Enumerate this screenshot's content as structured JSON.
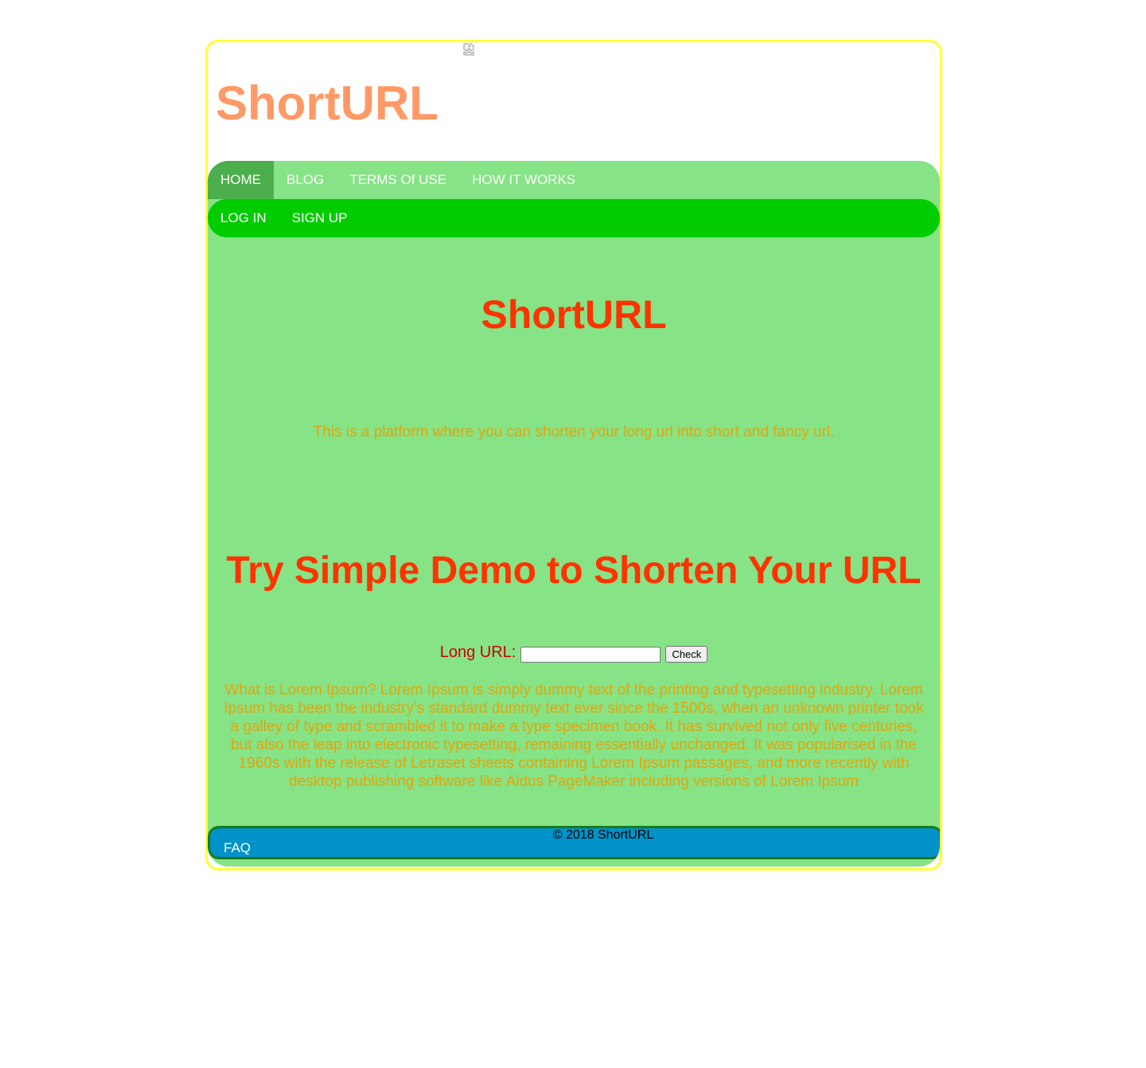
{
  "header": {
    "site_title": "ShortURL"
  },
  "nav": {
    "primary": [
      {
        "label": "HOME",
        "active": true
      },
      {
        "label": "BLOG",
        "active": false
      },
      {
        "label": "TERMS Of USE",
        "active": false
      },
      {
        "label": "HOW IT WORKS",
        "active": false
      }
    ],
    "secondary": [
      {
        "label": "LOG IN"
      },
      {
        "label": "SIGN UP"
      }
    ]
  },
  "main": {
    "hero_title": "ShortURL",
    "tagline": "This is a platform where you can shorten your long url into short and fancy url.",
    "demo_title": "Try Simple Demo to Shorten Your URL",
    "form": {
      "label": "Long URL:",
      "input_value": "",
      "button_label": "Check"
    },
    "lorem": "What is Lorem Ipsum? Lorem Ipsum is simply dummy text of the printing and typesetting industry. Lorem Ipsum has been the industry's standard dummy text ever since the 1500s, when an unknown printer took a galley of type and scrambled it to make a type specimen book. It has survived not only five centuries, but also the leap into electronic typesetting, remaining essentially unchanged. It was popularised in the 1960s with the release of Letraset sheets containing Lorem Ipsum passages, and more recently with desktop publishing software like Aldus PageMaker including versions of Lorem Ipsum"
  },
  "footer": {
    "faq_label": "FAQ",
    "copyright": "© 2018 ShortURL"
  },
  "colors": {
    "frame_border": "#ffff33",
    "site_title": "#ff9966",
    "green_panel": "#86e386",
    "nav_active": "#4cae4c",
    "secondary_nav": "#00cc00",
    "heading": "#ff3300",
    "body_text": "#e5a50a",
    "form_label": "#cc0000",
    "footer_bg": "#0092c8",
    "footer_border": "#1a7a1a"
  },
  "icons": {
    "header_image": "broken-image-icon"
  }
}
